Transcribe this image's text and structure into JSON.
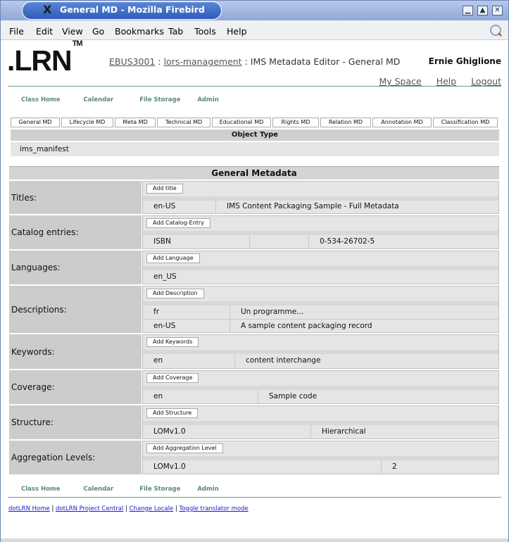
{
  "window": {
    "title": "General MD - Mozilla Firebird"
  },
  "menu": [
    "File",
    "Edit",
    "View",
    "Go",
    "Bookmarks",
    "Tab",
    "Tools",
    "Help"
  ],
  "header": {
    "logo": ".LRN",
    "logo_tm": "TM",
    "breadcrumb": {
      "course": "EBUS3001",
      "sep1": ":",
      "area": "lors-management",
      "sep2": ":",
      "page": "IMS Metadata Editor - General MD"
    },
    "username": "Ernie Ghiglione",
    "links": {
      "my_space": "My Space",
      "help": "Help",
      "logout": "Logout"
    }
  },
  "subnav": {
    "class_home": "Class Home",
    "calendar": "Calendar",
    "file_storage": "File Storage",
    "admin": "Admin"
  },
  "tabs": [
    "General MD",
    "Lifecycle MD",
    "Meta MD",
    "Technical MD",
    "Educational MD",
    "Rights MD",
    "Relation MD",
    "Annotation MD",
    "Classification MD"
  ],
  "object_type": {
    "header": "Object Type",
    "value": "ims_manifest"
  },
  "general_metadata": {
    "header": "General Metadata",
    "rows": [
      {
        "label": "Titles:",
        "button": "Add title",
        "data": [
          [
            "en-US",
            "IMS Content Packaging Sample - Full Metadata"
          ]
        ]
      },
      {
        "label": "Catalog entries:",
        "button": "Add Catalog-Entry",
        "data": [
          [
            "ISBN",
            "",
            "0-534-26702-5"
          ]
        ]
      },
      {
        "label": "Languages:",
        "button": "Add Language",
        "data": [
          [
            "en_US"
          ]
        ]
      },
      {
        "label": "Descriptions:",
        "button": "Add Description",
        "data": [
          [
            "fr",
            "Un programme..."
          ],
          [
            "en-US",
            "A sample content packaging record"
          ]
        ]
      },
      {
        "label": "Keywords:",
        "button": "Add Keywords",
        "data": [
          [
            "en",
            "content interchange"
          ]
        ]
      },
      {
        "label": "Coverage:",
        "button": "Add Coverage",
        "data": [
          [
            "en",
            "Sample code"
          ]
        ]
      },
      {
        "label": "Structure:",
        "button": "Add Structure",
        "data": [
          [
            "LOMv1.0",
            "Hierarchical"
          ]
        ]
      },
      {
        "label": "Aggregation Levels:",
        "button": "Add Aggregation Level",
        "data": [
          [
            "LOMv1.0",
            "2"
          ]
        ]
      }
    ]
  },
  "footer": {
    "home": "dotLRN Home",
    "project": "dotLRN Project Central",
    "locale": "Change Locale",
    "translator": "Toggle translator mode",
    "sep": "|"
  }
}
